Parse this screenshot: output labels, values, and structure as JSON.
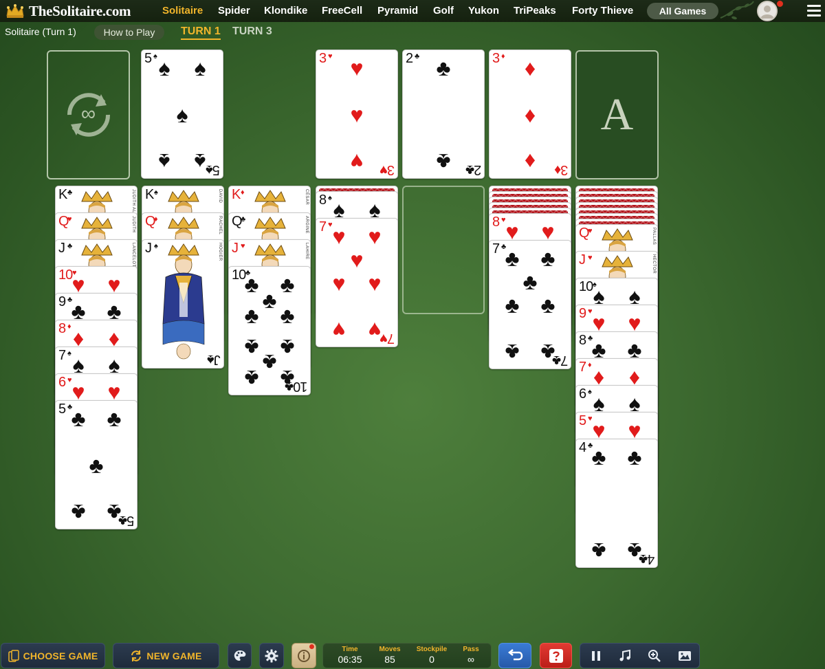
{
  "site": {
    "name": "TheSolitaire.com"
  },
  "nav": {
    "items": [
      "Solitaire",
      "Spider",
      "Klondike",
      "FreeCell",
      "Pyramid",
      "Golf",
      "Yukon",
      "TriPeaks",
      "Forty Thieve"
    ],
    "active": "Solitaire",
    "all_games": "All Games"
  },
  "sub": {
    "title": "Solitaire (Turn 1)",
    "how_to_play": "How to Play",
    "tabs": [
      "TURN 1",
      "TURN 3"
    ],
    "active_tab": "TURN 1"
  },
  "board": {
    "stock": {
      "icon": "infinity-recycle-icon",
      "label": "∞"
    },
    "waste": {
      "rank": "5",
      "suit": "♠"
    },
    "foundations": [
      {
        "rank": "3",
        "suit": "♥"
      },
      {
        "rank": "2",
        "suit": "♣"
      },
      {
        "rank": "3",
        "suit": "♦"
      },
      {
        "empty": true,
        "label": "A"
      }
    ],
    "tableau": [
      [
        {
          "rank": "K",
          "suit": "♣",
          "name": "JUDITH ALEXANDRE"
        },
        {
          "rank": "Q",
          "suit": "♥",
          "name": "JUDITH"
        },
        {
          "rank": "J",
          "suit": "♣",
          "name": "LANCELOT"
        },
        {
          "rank": "10",
          "suit": "♥"
        },
        {
          "rank": "9",
          "suit": "♣"
        },
        {
          "rank": "8",
          "suit": "♦"
        },
        {
          "rank": "7",
          "suit": "♠"
        },
        {
          "rank": "6",
          "suit": "♥"
        },
        {
          "rank": "5",
          "suit": "♣"
        }
      ],
      [
        {
          "rank": "K",
          "suit": "♠",
          "name": "DAVID"
        },
        {
          "rank": "Q",
          "suit": "♦",
          "name": "RACHEL"
        },
        {
          "rank": "J",
          "suit": "♠",
          "name": "HOGIER"
        }
      ],
      [
        {
          "rank": "K",
          "suit": "♦",
          "name": "CÉSAR"
        },
        {
          "rank": "Q",
          "suit": "♣",
          "name": "ARGINE"
        },
        {
          "rank": "J",
          "suit": "♥",
          "name": "LAHIRE"
        },
        {
          "rank": "10",
          "suit": "♣"
        }
      ],
      [
        {
          "back": true
        },
        {
          "rank": "8",
          "suit": "♠"
        },
        {
          "rank": "7",
          "suit": "♥"
        }
      ],
      [],
      [
        {
          "back": true
        },
        {
          "back": true
        },
        {
          "back": true
        },
        {
          "back": true
        },
        {
          "back": true
        },
        {
          "rank": "8",
          "suit": "♥"
        },
        {
          "rank": "7",
          "suit": "♣"
        }
      ],
      [
        {
          "back": true
        },
        {
          "back": true
        },
        {
          "back": true
        },
        {
          "back": true
        },
        {
          "back": true
        },
        {
          "back": true
        },
        {
          "back": true
        },
        {
          "rank": "Q",
          "suit": "♥",
          "name": "PALLAS"
        },
        {
          "rank": "J",
          "suit": "♥",
          "name": "HECTOR"
        },
        {
          "rank": "10",
          "suit": "♠"
        },
        {
          "rank": "9",
          "suit": "♥"
        },
        {
          "rank": "8",
          "suit": "♣"
        },
        {
          "rank": "7",
          "suit": "♦"
        },
        {
          "rank": "6",
          "suit": "♠"
        },
        {
          "rank": "5",
          "suit": "♥"
        },
        {
          "rank": "4",
          "suit": "♣"
        }
      ]
    ]
  },
  "toolbar": {
    "choose_game": "CHOOSE GAME",
    "new_game": "NEW GAME",
    "stats": {
      "time_label": "Time",
      "time": "06:35",
      "moves_label": "Moves",
      "moves": "85",
      "stockpile_label": "Stockpile",
      "stockpile": "0",
      "pass_label": "Pass",
      "pass": "∞"
    }
  },
  "colors": {
    "accent": "#f1b52b",
    "felt": "#3d6a30",
    "red": "#e11b1b"
  }
}
